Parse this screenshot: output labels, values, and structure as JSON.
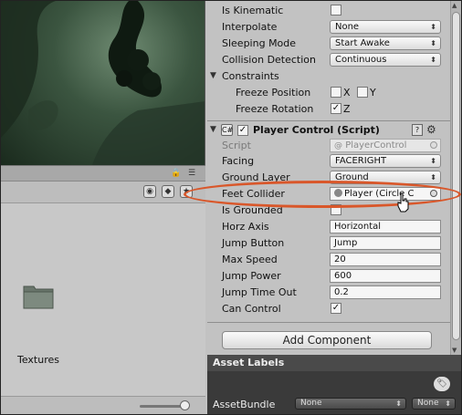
{
  "inspector": {
    "rigidbody": {
      "is_kinematic": {
        "label": "Is Kinematic",
        "checked": false
      },
      "interpolate": {
        "label": "Interpolate",
        "value": "None"
      },
      "sleeping_mode": {
        "label": "Sleeping Mode",
        "value": "Start Awake"
      },
      "collision_detection": {
        "label": "Collision Detection",
        "value": "Continuous"
      },
      "constraints": {
        "label": "Constraints"
      },
      "freeze_position": {
        "label": "Freeze Position",
        "x_label": "X",
        "y_label": "Y",
        "x_checked": false,
        "y_checked": false
      },
      "freeze_rotation": {
        "label": "Freeze Rotation",
        "z_label": "Z",
        "z_checked": true
      }
    },
    "player_control": {
      "title": "Player Control (Script)",
      "enabled": true,
      "script": {
        "label": "Script",
        "value": "PlayerControl"
      },
      "facing": {
        "label": "Facing",
        "value": "FACERIGHT"
      },
      "ground_layer": {
        "label": "Ground Layer",
        "value": "Ground"
      },
      "feet_collider": {
        "label": "Feet Collider",
        "value": "Player (Circle C"
      },
      "is_grounded": {
        "label": "Is Grounded",
        "checked": false
      },
      "horz_axis": {
        "label": "Horz Axis",
        "value": "Horizontal"
      },
      "jump_button": {
        "label": "Jump Button",
        "value": "Jump"
      },
      "max_speed": {
        "label": "Max Speed",
        "value": "20"
      },
      "jump_power": {
        "label": "Jump Power",
        "value": "600"
      },
      "jump_time_out": {
        "label": "Jump Time Out",
        "value": "0.2"
      },
      "can_control": {
        "label": "Can Control",
        "checked": true
      }
    },
    "add_component_label": "Add Component"
  },
  "asset_labels": {
    "title": "Asset Labels",
    "asset_bundle_label": "AssetBundle",
    "asset_bundle_value": "None",
    "variant_value": "None"
  },
  "project": {
    "folder_name": "Textures"
  },
  "colors": {
    "highlight": "#d9572a"
  }
}
